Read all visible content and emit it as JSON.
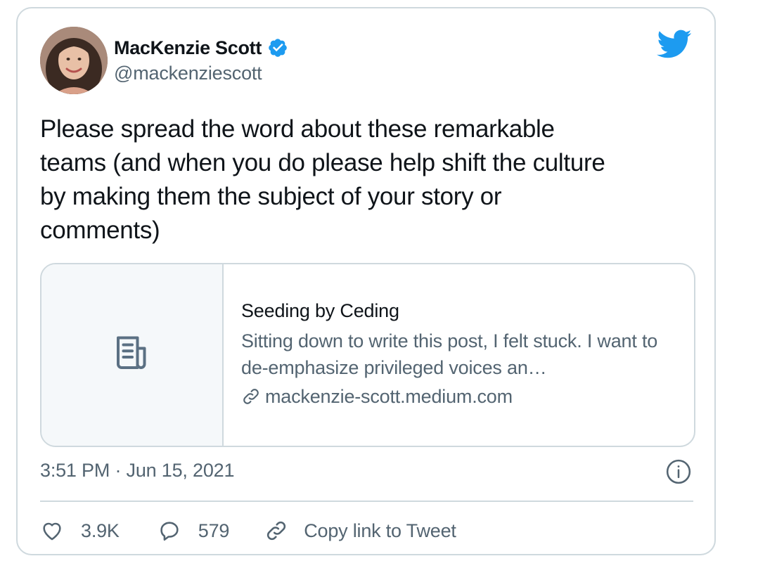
{
  "author": {
    "display_name": "MacKenzie Scott",
    "handle": "@mackenziescott",
    "verified": true
  },
  "tweet": {
    "text": "Please spread the word about these remarkable\nteams (and when you do please help shift the culture\nby making them the subject of your story or\ncomments)"
  },
  "link_card": {
    "title": "Seeding by Ceding",
    "description": "Sitting down to write this post, I felt stuck. I want to de-emphasize privileged voices an…",
    "domain": "mackenzie-scott.medium.com",
    "thumbnail_icon": "document-icon"
  },
  "meta": {
    "timestamp": "3:51 PM · Jun 15, 2021"
  },
  "actions": {
    "likes": "3.9K",
    "replies": "579",
    "copy_link_label": "Copy link to Tweet"
  },
  "colors": {
    "twitter_blue": "#1d9bf0",
    "text_primary": "#0f1419",
    "text_secondary": "#536471",
    "border": "#cfd9de"
  },
  "icons": {
    "brand": "twitter-bird-icon",
    "verified": "verified-badge-icon",
    "info": "info-icon",
    "like": "heart-icon",
    "reply": "reply-bubble-icon",
    "copy": "link-icon"
  }
}
